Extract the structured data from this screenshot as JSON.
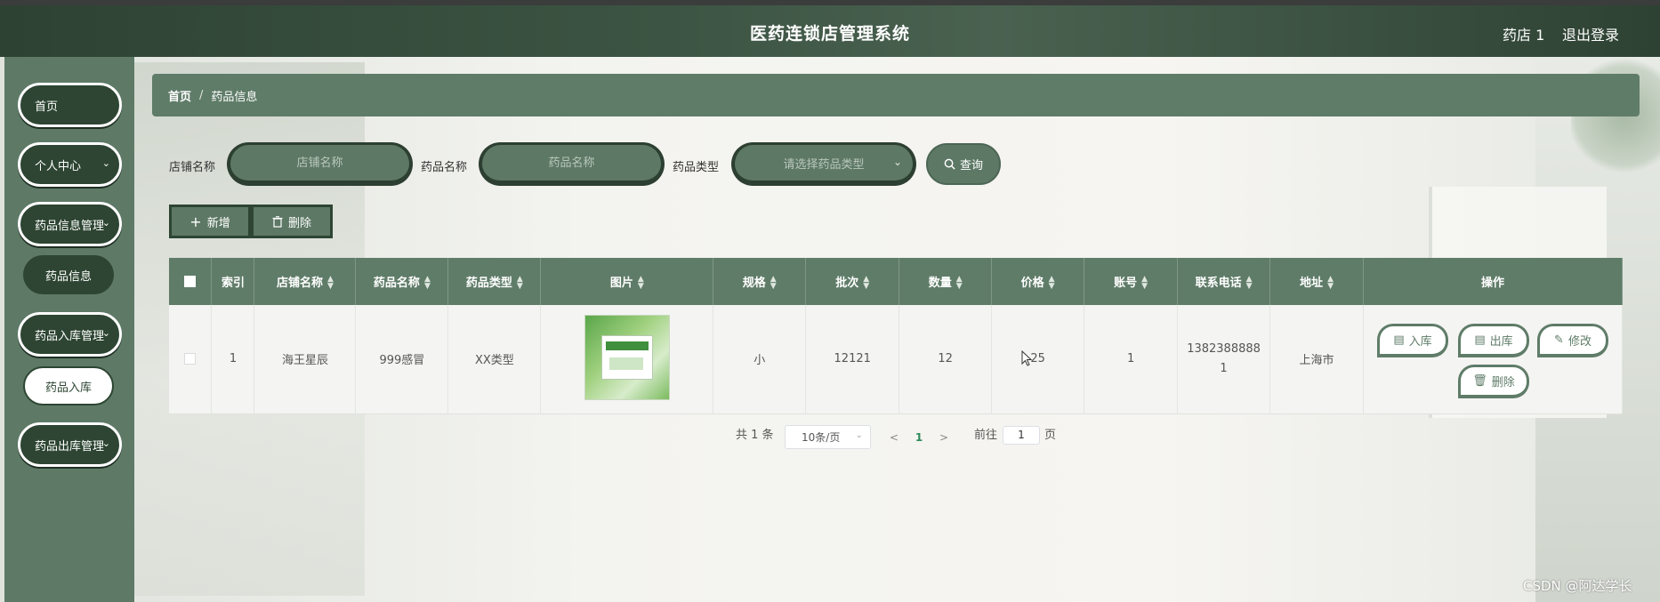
{
  "header": {
    "title": "医药连锁店管理系统",
    "user": "药店 1",
    "logout": "退出登录"
  },
  "sidebar": {
    "items": [
      {
        "label": "首页"
      },
      {
        "label": "个人中心",
        "arrow": "⌄"
      },
      {
        "label": "药品信息管理",
        "arrow": "⌄"
      },
      {
        "label": "药品信息"
      },
      {
        "label": "药品入库管理",
        "arrow": "⌄"
      },
      {
        "label": "药品入库"
      },
      {
        "label": "药品出库管理",
        "arrow": "⌄"
      }
    ]
  },
  "breadcrumb": {
    "home": "首页",
    "sep": "/",
    "current": "药品信息"
  },
  "search": {
    "shop_label": "店铺名称",
    "shop_placeholder": "店铺名称",
    "drug_label": "药品名称",
    "drug_placeholder": "药品名称",
    "type_label": "药品类型",
    "type_placeholder": "请选择药品类型",
    "query": "查询"
  },
  "actions": {
    "add": "新增",
    "delete": "删除"
  },
  "table": {
    "columns": [
      "索引",
      "店铺名称",
      "药品名称",
      "药品类型",
      "图片",
      "规格",
      "批次",
      "数量",
      "价格",
      "账号",
      "联系电话",
      "地址",
      "操作"
    ],
    "rows": [
      {
        "index": "1",
        "shop": "海王星辰",
        "drug": "999感冒",
        "type": "XX类型",
        "spec": "小",
        "batch": "12121",
        "qty": "12",
        "price": "25",
        "account": "1",
        "phone_line1": "1382388888",
        "phone_line2": "1",
        "address": "上海市",
        "ops": {
          "in": "入库",
          "out": "出库",
          "edit": "修改",
          "delete": "删除"
        }
      }
    ]
  },
  "pagination": {
    "total": "共 1 条",
    "page_size": "10条/页",
    "current_page": "1",
    "goto_label": "前往",
    "goto_value": "1",
    "page_suffix": "页"
  },
  "watermark": "CSDN @阿达学长",
  "colors": {
    "primary": "#5f7c68",
    "dark": "#2d4532",
    "header": "#3c5443"
  }
}
